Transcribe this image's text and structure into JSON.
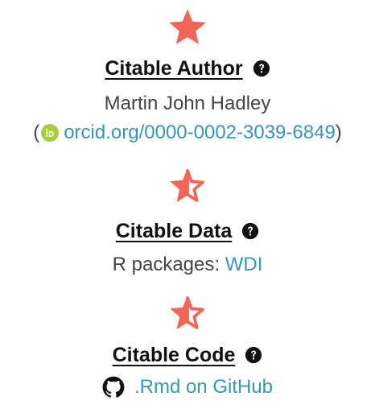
{
  "author": {
    "heading": "Citable Author",
    "name": "Martin John Hadley",
    "open_paren": "(",
    "orcid_link": "orcid.org/0000-0002-3039-6849",
    "close_paren": ")",
    "star_icon": "star-full-icon"
  },
  "data": {
    "heading": "Citable Data",
    "prefix": "R packages:",
    "package_link": "WDI",
    "star_icon": "star-half-icon"
  },
  "code": {
    "heading": "Citable Code",
    "link": ".Rmd on GitHub",
    "star_icon": "star-half-icon"
  },
  "colors": {
    "star": "#f26556",
    "link": "#3a96b0",
    "orcid": "#a6ce39",
    "text": "#444444"
  }
}
